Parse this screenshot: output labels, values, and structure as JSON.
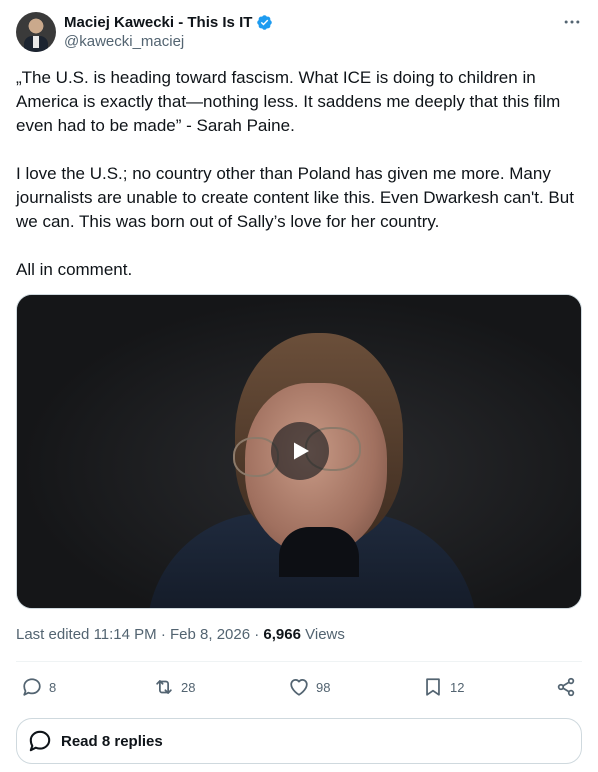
{
  "author": {
    "display_name": "Maciej Kawecki - This Is IT",
    "handle": "@kawecki_maciej",
    "verified": true,
    "verified_color": "#1d9bf0"
  },
  "more_icon": "more-horizontal-icon",
  "tweet": {
    "paragraphs": [
      "„The U.S. is heading toward fascism. What ICE is doing to children in America is exactly that—nothing less. It saddens me deeply that this film even had to be made” - Sarah Paine.",
      "I love the U.S.; no country other than Poland has given me more. Many journalists are unable to create content like this. Even Dwarkesh can't. But we can. This was born out of Sally’s love for her country.",
      "All in comment."
    ]
  },
  "media": {
    "type": "video",
    "play_icon": "play-icon"
  },
  "meta": {
    "edited_prefix": "Last edited",
    "time": "11:14 PM",
    "separator": "·",
    "date": "Feb 8, 2026",
    "views_count": "6,966",
    "views_label": "Views"
  },
  "actions": {
    "replies": "8",
    "reposts": "28",
    "likes": "98",
    "bookmarks": "12"
  },
  "read_replies": {
    "label": "Read 8 replies"
  },
  "colors": {
    "text_primary": "#0f1419",
    "text_secondary": "#536471",
    "border": "#cfd9de"
  }
}
